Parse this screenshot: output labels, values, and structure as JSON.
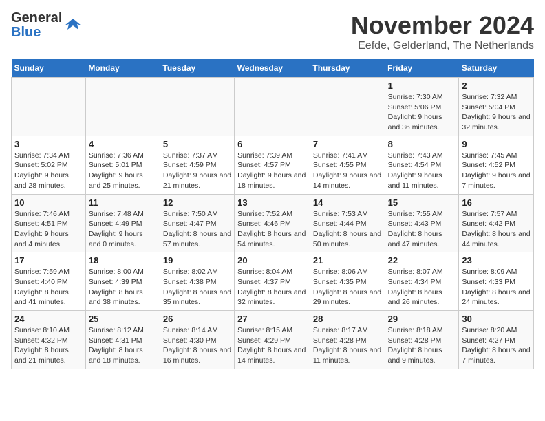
{
  "logo": {
    "line1": "General",
    "line2": "Blue"
  },
  "title": "November 2024",
  "location": "Eefde, Gelderland, The Netherlands",
  "weekdays": [
    "Sunday",
    "Monday",
    "Tuesday",
    "Wednesday",
    "Thursday",
    "Friday",
    "Saturday"
  ],
  "weeks": [
    [
      {
        "day": "",
        "info": ""
      },
      {
        "day": "",
        "info": ""
      },
      {
        "day": "",
        "info": ""
      },
      {
        "day": "",
        "info": ""
      },
      {
        "day": "",
        "info": ""
      },
      {
        "day": "1",
        "info": "Sunrise: 7:30 AM\nSunset: 5:06 PM\nDaylight: 9 hours and 36 minutes."
      },
      {
        "day": "2",
        "info": "Sunrise: 7:32 AM\nSunset: 5:04 PM\nDaylight: 9 hours and 32 minutes."
      }
    ],
    [
      {
        "day": "3",
        "info": "Sunrise: 7:34 AM\nSunset: 5:02 PM\nDaylight: 9 hours and 28 minutes."
      },
      {
        "day": "4",
        "info": "Sunrise: 7:36 AM\nSunset: 5:01 PM\nDaylight: 9 hours and 25 minutes."
      },
      {
        "day": "5",
        "info": "Sunrise: 7:37 AM\nSunset: 4:59 PM\nDaylight: 9 hours and 21 minutes."
      },
      {
        "day": "6",
        "info": "Sunrise: 7:39 AM\nSunset: 4:57 PM\nDaylight: 9 hours and 18 minutes."
      },
      {
        "day": "7",
        "info": "Sunrise: 7:41 AM\nSunset: 4:55 PM\nDaylight: 9 hours and 14 minutes."
      },
      {
        "day": "8",
        "info": "Sunrise: 7:43 AM\nSunset: 4:54 PM\nDaylight: 9 hours and 11 minutes."
      },
      {
        "day": "9",
        "info": "Sunrise: 7:45 AM\nSunset: 4:52 PM\nDaylight: 9 hours and 7 minutes."
      }
    ],
    [
      {
        "day": "10",
        "info": "Sunrise: 7:46 AM\nSunset: 4:51 PM\nDaylight: 9 hours and 4 minutes."
      },
      {
        "day": "11",
        "info": "Sunrise: 7:48 AM\nSunset: 4:49 PM\nDaylight: 9 hours and 0 minutes."
      },
      {
        "day": "12",
        "info": "Sunrise: 7:50 AM\nSunset: 4:47 PM\nDaylight: 8 hours and 57 minutes."
      },
      {
        "day": "13",
        "info": "Sunrise: 7:52 AM\nSunset: 4:46 PM\nDaylight: 8 hours and 54 minutes."
      },
      {
        "day": "14",
        "info": "Sunrise: 7:53 AM\nSunset: 4:44 PM\nDaylight: 8 hours and 50 minutes."
      },
      {
        "day": "15",
        "info": "Sunrise: 7:55 AM\nSunset: 4:43 PM\nDaylight: 8 hours and 47 minutes."
      },
      {
        "day": "16",
        "info": "Sunrise: 7:57 AM\nSunset: 4:42 PM\nDaylight: 8 hours and 44 minutes."
      }
    ],
    [
      {
        "day": "17",
        "info": "Sunrise: 7:59 AM\nSunset: 4:40 PM\nDaylight: 8 hours and 41 minutes."
      },
      {
        "day": "18",
        "info": "Sunrise: 8:00 AM\nSunset: 4:39 PM\nDaylight: 8 hours and 38 minutes."
      },
      {
        "day": "19",
        "info": "Sunrise: 8:02 AM\nSunset: 4:38 PM\nDaylight: 8 hours and 35 minutes."
      },
      {
        "day": "20",
        "info": "Sunrise: 8:04 AM\nSunset: 4:37 PM\nDaylight: 8 hours and 32 minutes."
      },
      {
        "day": "21",
        "info": "Sunrise: 8:06 AM\nSunset: 4:35 PM\nDaylight: 8 hours and 29 minutes."
      },
      {
        "day": "22",
        "info": "Sunrise: 8:07 AM\nSunset: 4:34 PM\nDaylight: 8 hours and 26 minutes."
      },
      {
        "day": "23",
        "info": "Sunrise: 8:09 AM\nSunset: 4:33 PM\nDaylight: 8 hours and 24 minutes."
      }
    ],
    [
      {
        "day": "24",
        "info": "Sunrise: 8:10 AM\nSunset: 4:32 PM\nDaylight: 8 hours and 21 minutes."
      },
      {
        "day": "25",
        "info": "Sunrise: 8:12 AM\nSunset: 4:31 PM\nDaylight: 8 hours and 18 minutes."
      },
      {
        "day": "26",
        "info": "Sunrise: 8:14 AM\nSunset: 4:30 PM\nDaylight: 8 hours and 16 minutes."
      },
      {
        "day": "27",
        "info": "Sunrise: 8:15 AM\nSunset: 4:29 PM\nDaylight: 8 hours and 14 minutes."
      },
      {
        "day": "28",
        "info": "Sunrise: 8:17 AM\nSunset: 4:28 PM\nDaylight: 8 hours and 11 minutes."
      },
      {
        "day": "29",
        "info": "Sunrise: 8:18 AM\nSunset: 4:28 PM\nDaylight: 8 hours and 9 minutes."
      },
      {
        "day": "30",
        "info": "Sunrise: 8:20 AM\nSunset: 4:27 PM\nDaylight: 8 hours and 7 minutes."
      }
    ]
  ]
}
